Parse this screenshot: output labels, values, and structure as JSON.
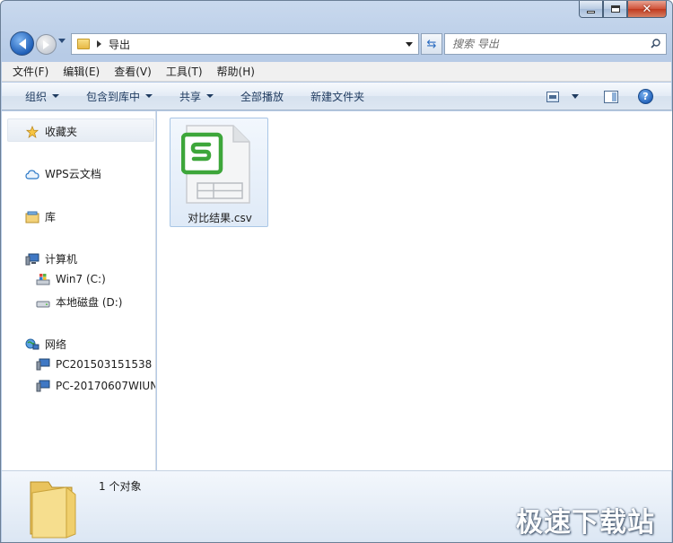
{
  "window": {
    "address_crumb": "导出"
  },
  "search": {
    "placeholder": "搜索 导出"
  },
  "menu": [
    {
      "label": "文件(F)"
    },
    {
      "label": "编辑(E)"
    },
    {
      "label": "查看(V)"
    },
    {
      "label": "工具(T)"
    },
    {
      "label": "帮助(H)"
    }
  ],
  "toolbar": {
    "organize": "组织",
    "include_in_library": "包含到库中",
    "share": "共享",
    "play_all": "全部播放",
    "new_folder": "新建文件夹"
  },
  "nav": {
    "favorites": "收藏夹",
    "wps_cloud": "WPS云文档",
    "libraries": "库",
    "computer": "计算机",
    "drive_c": "Win7 (C:)",
    "drive_d": "本地磁盘 (D:)",
    "network": "网络",
    "pc1": "PC201503151538",
    "pc2": "PC-20170607WIUN"
  },
  "files": [
    {
      "name": "对比结果.csv",
      "icon": "wps-spreadsheet-icon"
    }
  ],
  "details": {
    "count": "1 个对象"
  },
  "watermark": "极速下载站",
  "colors": {
    "wps_green": "#3da63a",
    "selection_border": "#a9c6e6",
    "chrome_blue": "#b7cbe6"
  }
}
